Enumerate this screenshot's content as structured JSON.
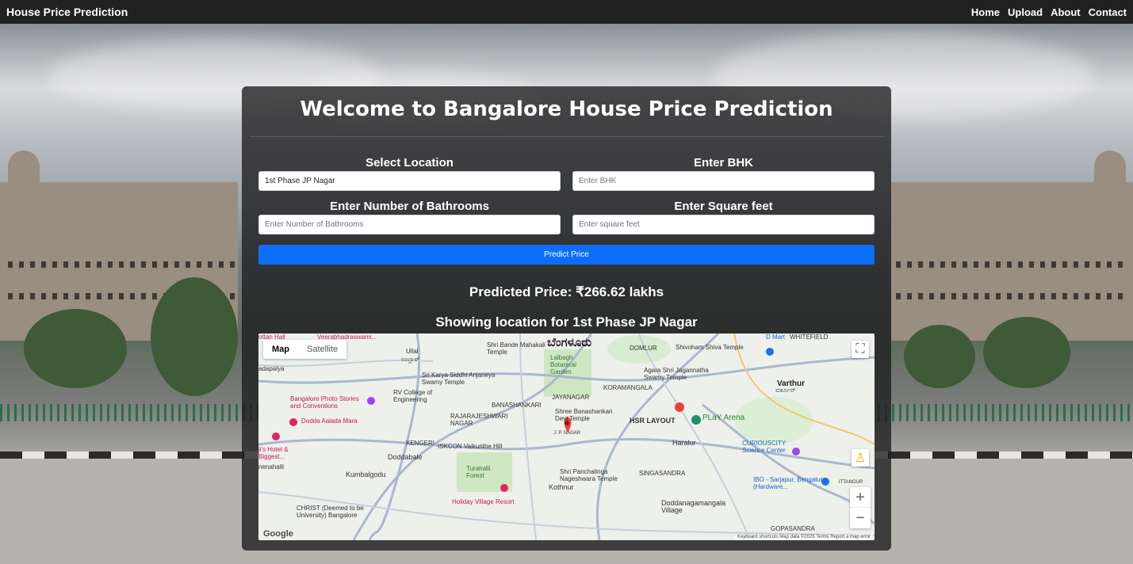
{
  "navbar": {
    "brand": "House Price Prediction",
    "links": [
      "Home",
      "Upload",
      "About",
      "Contact"
    ]
  },
  "form": {
    "title": "Welcome to Bangalore House Price Prediction",
    "location_label": "Select Location",
    "location_value": "1st Phase JP Nagar",
    "bhk_label": "Enter BHK",
    "bhk_placeholder": "Enter BHK",
    "bath_label": "Enter Number of Bathrooms",
    "bath_placeholder": "Enter Number of Bathrooms",
    "sqft_label": "Enter Square feet",
    "sqft_placeholder": "Enter square feet",
    "button": "Predict Price"
  },
  "result": {
    "price": "Predicted Price: ₹266.62 lakhs",
    "location": "Showing location for 1st Phase JP Nagar"
  },
  "map": {
    "type_tabs": [
      "Map",
      "Satellite"
    ],
    "selected_tab": "Map",
    "city_label": "ಬೆಂಗಳೂರು",
    "places": [
      "Ullal",
      "ಉಲ್ಲಾಳ್",
      "Shri Bande Mahakali Temple",
      "Lalbagh Botanical Garden",
      "DOMLUR",
      "Shivoham Shiva Temple",
      "D Mart",
      "WHITEFIELD",
      "Agara Shri Jagannatha Swamy Temple",
      "Sri Karya Siddhi Anjaneya Swamy Temple",
      "RV College of Engineering",
      "KORAMANGALA",
      "Varthur",
      "ವರ್ತೂರ್",
      "BANASHANKARI",
      "JAYANAGAR",
      "Shree Banashankari Devi Temple",
      "Bangalore Photo Stories and Conventions",
      "RAJARAJESHWARI NAGAR",
      "HSR LAYOUT",
      "PLaY Arena",
      "Dodda Aalada Mara",
      "ISKCON Vaikunthe Hill",
      "Haralur",
      "KENGERI",
      "Doddabale",
      "CURIOUSCITY Science Center",
      "J. P. NAGAR",
      "Turahalli Forest",
      "Shri Panchalinga Nageshwara Temple",
      "SINGASANDRA",
      "Kumbalgodu",
      "IBO - Sarjapur, Bengaluru (Hardware...",
      "Holiday Village Resort",
      "Kothnur",
      "Doddanagamangala Village",
      "CHRIST (Deemed to be University) Bangalore",
      "GOPASANDRA",
      "adapalya",
      "ji's Hotel & Biggest...",
      "nenahalli",
      "ottan Hall",
      "Veerabhadraswami...",
      "ITTANGUR"
    ],
    "attribution": "Keyboard shortcuts   Map data ©2025   Terms   Report a map error",
    "logo": "Google"
  },
  "colors": {
    "navbar": "#212121",
    "card": "#1c1c1e",
    "button": "#0d6efd",
    "marker": "#ea4335"
  }
}
